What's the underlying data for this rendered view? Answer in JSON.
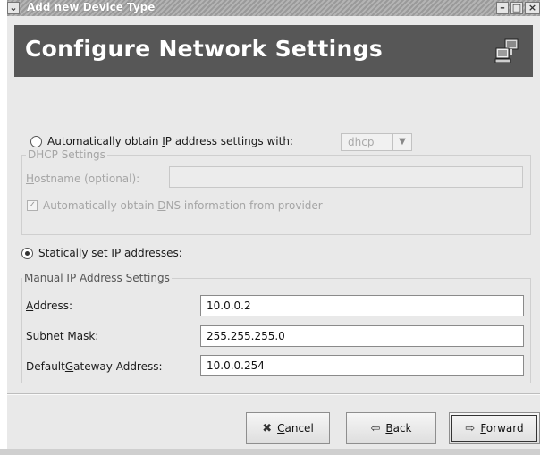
{
  "window": {
    "title": "Add new Device Type",
    "menu_glyph": "⌄",
    "minimize_glyph": "–",
    "maximize_glyph": "□",
    "close_glyph": "×"
  },
  "header": {
    "title": "Configure Network Settings",
    "icon": "network-computer-icon"
  },
  "auto_ip": {
    "label_pre": "Automatically obtain ",
    "label_u": "I",
    "label_post": "P address settings with:",
    "selected": false,
    "method_value": "dhcp",
    "method_arrow": "▼"
  },
  "dhcp": {
    "group_label": "DHCP Settings",
    "hostname_label_u": "H",
    "hostname_label_rest": "ostname (optional):",
    "hostname_value": "",
    "dns_label_pre": "Automatically obtain ",
    "dns_label_u": "D",
    "dns_label_post": "NS information from provider",
    "dns_checked": true,
    "check_glyph": "✓"
  },
  "static": {
    "label": "Statically set IP addresses:",
    "selected": true,
    "group_label": "Manual IP Address Settings",
    "address_label_u": "A",
    "address_label_rest": "ddress:",
    "address_value": "10.0.0.2",
    "subnet_label_u": "S",
    "subnet_label_rest": "ubnet Mask:",
    "subnet_value": "255.255.255.0",
    "gateway_label_pre": "Default ",
    "gateway_label_u": "G",
    "gateway_label_post": "ateway Address:",
    "gateway_value": "10.0.0.254"
  },
  "buttons": {
    "cancel_icon": "✖",
    "cancel_u": "C",
    "cancel_rest": "ancel",
    "back_icon": "⇦",
    "back_u": "B",
    "back_rest": "ack",
    "forward_icon": "⇨",
    "forward_u": "F",
    "forward_rest": "orward"
  },
  "colors": {
    "header_bg": "#575757",
    "window_bg": "#e9e9e9",
    "titlebar": "#a6a6a6"
  }
}
